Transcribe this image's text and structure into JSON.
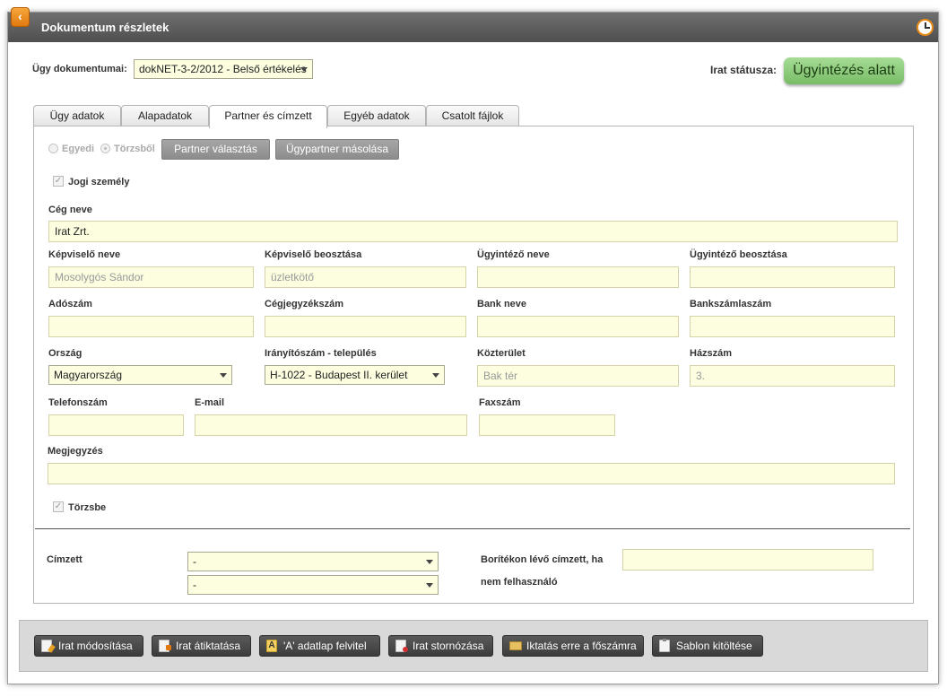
{
  "window": {
    "title": "Dokumentum részletek"
  },
  "header": {
    "ugy_label": "Ügy dokumentumai:",
    "ugy_value": "dokNET-3-2/2012 - Belső értékelés",
    "status_label": "Irat státusza:",
    "status_value": "Ügyintézés alatt",
    "status_color": "#8fcf7e"
  },
  "tabs": [
    {
      "label": "Ügy adatok",
      "active": false
    },
    {
      "label": "Alapadatok",
      "active": false
    },
    {
      "label": "Partner és címzett",
      "active": true
    },
    {
      "label": "Egyéb adatok",
      "active": false
    },
    {
      "label": "Csatolt fájlok",
      "active": false
    }
  ],
  "partner": {
    "radio_egyedi": "Egyedi",
    "radio_torzsbol": "Törzsből",
    "btn_partner_valasztas": "Partner választás",
    "btn_ugypartner_masolasa": "Ügypartner másolása",
    "jogi_szemely_label": "Jogi személy",
    "ceg_neve_label": "Cég neve",
    "ceg_neve_value": "Irat Zrt.",
    "kepviselo_neve_label": "Képviselő neve",
    "kepviselo_neve_value": "Mosolygós Sándor",
    "kepviselo_beosztasa_label": "Képviselő beosztása",
    "kepviselo_beosztasa_value": "üzletkötő",
    "ugyintezo_neve_label": "Ügyintéző neve",
    "ugyintezo_neve_value": "",
    "ugyintezo_beosztasa_label": "Ügyintéző beosztása",
    "ugyintezo_beosztasa_value": "",
    "adoszam_label": "Adószám",
    "adoszam_value": "",
    "cegjegyzekszam_label": "Cégjegyzékszám",
    "cegjegyzekszam_value": "",
    "bank_neve_label": "Bank neve",
    "bank_neve_value": "",
    "bankszamlaszam_label": "Bankszámlaszám",
    "bankszamlaszam_value": "",
    "orszag_label": "Ország",
    "orszag_value": "Magyarország",
    "iranyitoszam_label": "Irányítószám - település",
    "iranyitoszam_value": "H-1022 - Budapest II. kerület",
    "kozterulet_label": "Közterület",
    "kozterulet_value": "Bak tér",
    "hazszam_label": "Házszám",
    "hazszam_value": "3.",
    "telefonszam_label": "Telefonszám",
    "telefonszam_value": "",
    "email_label": "E-mail",
    "email_value": "",
    "faxszam_label": "Faxszám",
    "faxszam_value": "",
    "megjegyzes_label": "Megjegyzés",
    "megjegyzes_value": "",
    "torzsbe_label": "Törzsbe"
  },
  "cimzett": {
    "label": "Címzett",
    "select1_value": "-",
    "select2_value": "-",
    "boritek_label_line1": "Borítékon lévő címzett, ha",
    "boritek_label_line2": "nem felhasználó",
    "boritek_value": ""
  },
  "actions": [
    {
      "label": "Irat módosítása",
      "icon": "edit-icon"
    },
    {
      "label": "Irat átiktatása",
      "icon": "move-document-icon"
    },
    {
      "label": "'A' adatlap felvitel",
      "icon": "form-a-icon"
    },
    {
      "label": "Irat stornózása",
      "icon": "cancel-document-icon"
    },
    {
      "label": "Iktatás erre a főszámra",
      "icon": "folder-icon"
    },
    {
      "label": "Sablon kitöltése",
      "icon": "clipboard-icon"
    }
  ]
}
